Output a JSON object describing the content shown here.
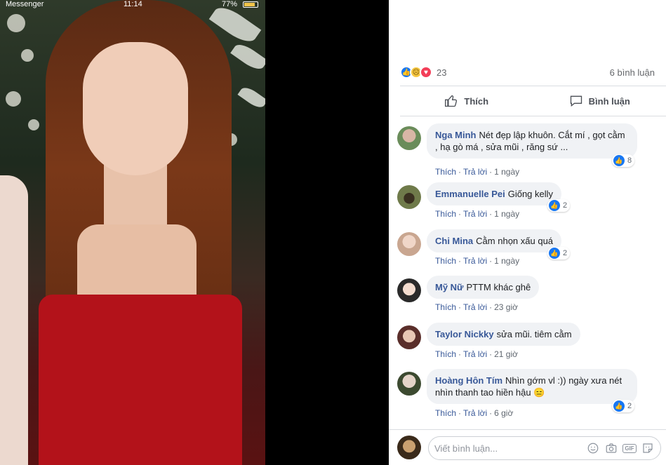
{
  "status_bar": {
    "carrier": "Messenger",
    "time": "11:14",
    "battery": "77%"
  },
  "post": {
    "reaction_count": "23",
    "comment_count": "6 bình luận",
    "like_label": "Thích",
    "comment_label": "Bình luận",
    "reaction_icons": [
      "like-icon",
      "sad-icon",
      "love-icon"
    ]
  },
  "comments": [
    {
      "author": "Nga Minh",
      "text": "Nét đẹp lập khuôn. Cắt mí , gọt cằm , hạ gò má , sửa mũi , răng sứ ...",
      "reply_like": "Thích",
      "reply": "Trả lời",
      "time": "1 ngày",
      "likes": "8"
    },
    {
      "author": "Emmanuelle Pei",
      "text": "Giống kelly",
      "reply_like": "Thích",
      "reply": "Trả lời",
      "time": "1 ngày",
      "likes": "2"
    },
    {
      "author": "Chi Mina",
      "text": "Cằm nhọn xấu quá",
      "reply_like": "Thích",
      "reply": "Trả lời",
      "time": "1 ngày",
      "likes": "2"
    },
    {
      "author": "Mỹ Nữ",
      "text": "PTTM khác ghê",
      "reply_like": "Thích",
      "reply": "Trả lời",
      "time": "23 giờ",
      "likes": ""
    },
    {
      "author": "Taylor Nickky",
      "text": "sửa mũi. tiêm cằm",
      "reply_like": "Thích",
      "reply": "Trả lời",
      "time": "21 giờ",
      "likes": ""
    },
    {
      "author": "Hoàng Hôn Tím",
      "text": "Nhìn gớm vl :)) ngày xưa nét nhìn thanh tao hiền hậu 😑",
      "reply_like": "Thích",
      "reply": "Trả lời",
      "time": "6 giờ",
      "likes": "2"
    }
  ],
  "composer": {
    "placeholder": "Viết bình luận...",
    "gif_label": "GIF"
  }
}
